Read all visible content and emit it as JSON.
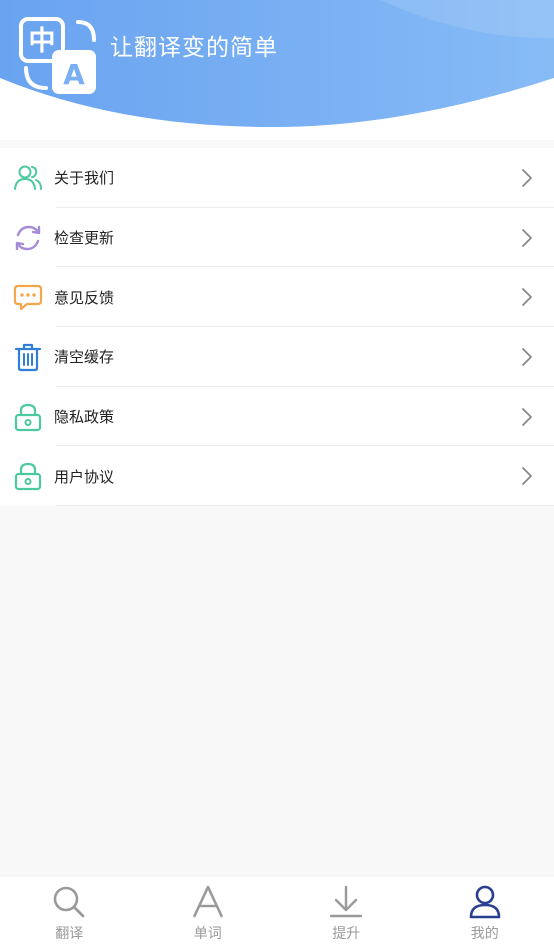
{
  "header": {
    "title": "让翻译变的简单",
    "logo_glyph_cn": "中",
    "logo_glyph_en": "A"
  },
  "menu": {
    "items": [
      {
        "label": "关于我们",
        "icon": "users-icon",
        "color": "#4cc9a0"
      },
      {
        "label": "检查更新",
        "icon": "refresh-icon",
        "color": "#a58bd8"
      },
      {
        "label": "意见反馈",
        "icon": "chat-icon",
        "color": "#f2a74a"
      },
      {
        "label": "清空缓存",
        "icon": "trash-icon",
        "color": "#2f7fd8"
      },
      {
        "label": "隐私政策",
        "icon": "lock-icon",
        "color": "#4cc9a0"
      },
      {
        "label": "用户协议",
        "icon": "lock-icon",
        "color": "#4cc9a0"
      }
    ]
  },
  "tabbar": {
    "tabs": [
      {
        "label": "翻译",
        "icon": "search-icon"
      },
      {
        "label": "单词",
        "icon": "letter-a-icon"
      },
      {
        "label": "提升",
        "icon": "download-icon"
      },
      {
        "label": "我的",
        "icon": "user-icon",
        "active": true
      }
    ]
  },
  "colors": {
    "header_blue": "#6fa8f2",
    "active_tab": "#2a3f8f",
    "inactive_tab": "#9a9a9a"
  }
}
